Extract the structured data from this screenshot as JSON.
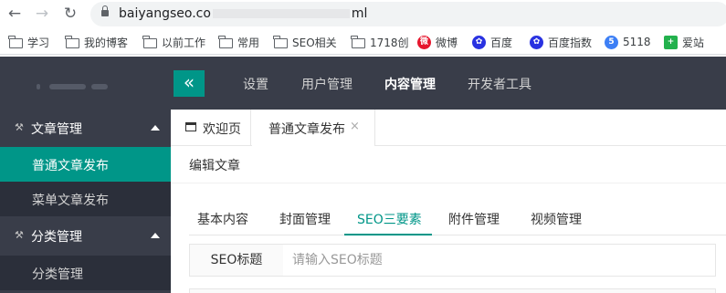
{
  "browser": {
    "url_prefix": "baiyangseo.co",
    "url_suffix": "ml",
    "bookmarks": [
      {
        "label": "学习",
        "icon": "folder-icon"
      },
      {
        "label": "我的博客",
        "icon": "folder-icon"
      },
      {
        "label": "以前工作",
        "icon": "folder-icon"
      },
      {
        "label": "常用",
        "icon": "folder-icon"
      },
      {
        "label": "SEO相关",
        "icon": "folder-icon"
      },
      {
        "label": "1718创",
        "icon": "folder-icon"
      },
      {
        "label": "微博",
        "icon": "weibo-icon"
      },
      {
        "label": "百度",
        "icon": "baidu-paw-icon"
      },
      {
        "label": "百度指数",
        "icon": "baidu-paw-icon"
      },
      {
        "label": "5118",
        "icon": "5118-icon"
      },
      {
        "label": "爱站",
        "icon": "aizhan-icon"
      }
    ]
  },
  "header": {
    "collapse_icon": "«",
    "nav": [
      {
        "label": "设置",
        "active": false
      },
      {
        "label": "用户管理",
        "active": false
      },
      {
        "label": "内容管理",
        "active": true
      },
      {
        "label": "开发者工具",
        "active": false
      }
    ]
  },
  "sidebar": {
    "groups": [
      {
        "label": "文章管理",
        "items": [
          "普通文章发布",
          "菜单文章发布"
        ]
      },
      {
        "label": "分类管理",
        "items": [
          "分类管理"
        ]
      }
    ],
    "active_item": "普通文章发布"
  },
  "tabs": {
    "home": "欢迎页",
    "current": "普通文章发布",
    "close": "×"
  },
  "card": {
    "title": "编辑文章"
  },
  "subtabs": [
    "基本内容",
    "封面管理",
    "SEO三要素",
    "附件管理",
    "视频管理"
  ],
  "subtab_active": "SEO三要素",
  "form": {
    "seo_title_label": "SEO标题",
    "seo_title_value": "",
    "seo_title_placeholder": "请输入SEO标题"
  },
  "colors": {
    "accent": "#009688",
    "dark": "#393d49",
    "darker": "#2b2f3a"
  }
}
